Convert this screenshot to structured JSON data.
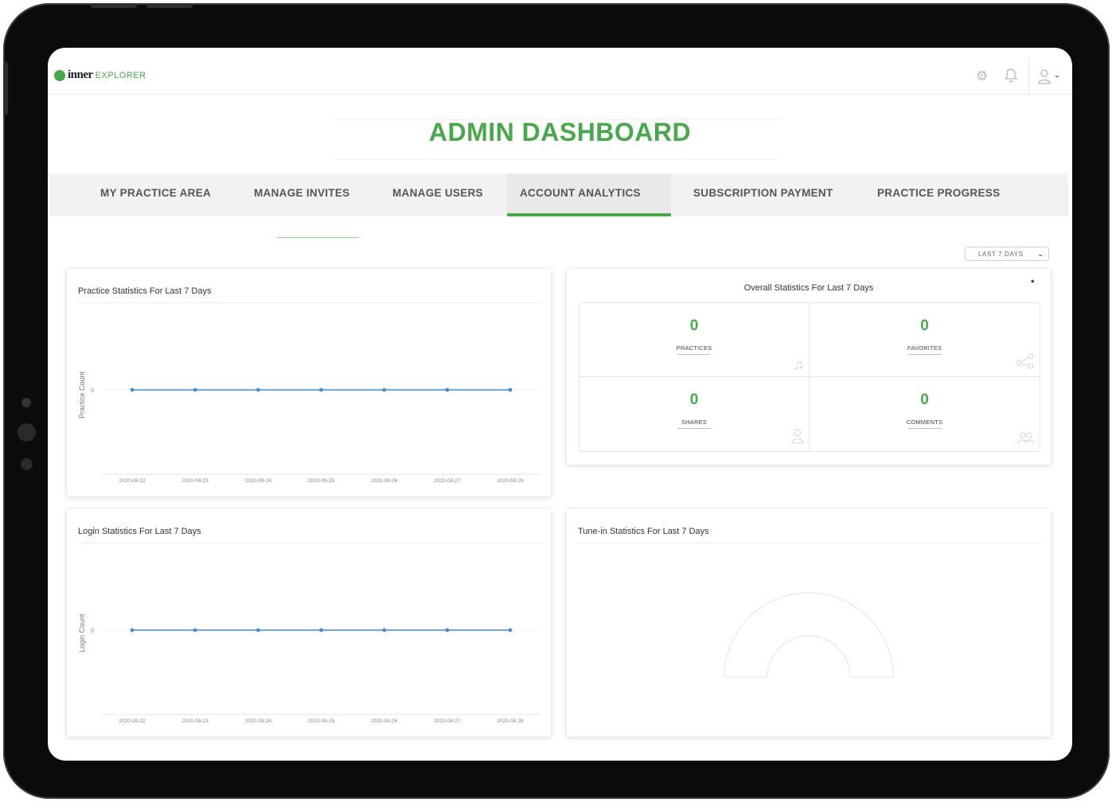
{
  "app": {
    "logo_inner": "inner",
    "logo_explorer": "EXPLORER",
    "page_title": "ADMIN DASHBOARD"
  },
  "header_icons": {
    "settings": "gear-icon",
    "notifications": "bell-icon",
    "user": "user-icon"
  },
  "tabs": [
    {
      "label": "MY PRACTICE AREA",
      "active": false
    },
    {
      "label": "MANAGE INVITES",
      "active": false
    },
    {
      "label": "MANAGE USERS",
      "active": false
    },
    {
      "label": "ACCOUNT ANALYTICS",
      "active": true
    },
    {
      "label": "SUBSCRIPTION PAYMENT",
      "active": false
    },
    {
      "label": "PRACTICE PROGRESS",
      "active": false
    }
  ],
  "filter": {
    "selected": "LAST 7 DAYS"
  },
  "practice_card": {
    "title": "Practice Statistics For Last 7 Days"
  },
  "overall_card": {
    "title": "Overall Statistics For Last 7 Days",
    "info_icon": "info-icon",
    "stats": [
      {
        "value": "0",
        "label": "PRACTICES",
        "icon": "music-icon"
      },
      {
        "value": "0",
        "label": "FAVORITES",
        "icon": "share-icon"
      },
      {
        "value": "0",
        "label": "SHARES",
        "icon": "person-icon"
      },
      {
        "value": "0",
        "label": "COMMENTS",
        "icon": "group-icon"
      }
    ]
  },
  "login_card": {
    "title": "Login Statistics For Last 7 Days"
  },
  "tunein_card": {
    "title": "Tune-in Statistics For Last 7 Days"
  },
  "colors": {
    "accent": "#49a84c",
    "line": "#3d8fd6"
  },
  "chart_data": [
    {
      "type": "line",
      "x": [
        "2020-08-22",
        "2020-08-23",
        "2020-08-24",
        "2020-08-25",
        "2020-08-26",
        "2020-08-27",
        "2020-08-28"
      ],
      "series": [
        {
          "values": [
            0,
            0,
            0,
            0,
            0,
            0,
            0
          ]
        }
      ],
      "ylabel": "Practice Count",
      "yticks": [
        "0"
      ]
    },
    {
      "type": "line",
      "x": [
        "2020-08-22",
        "2020-08-23",
        "2020-08-24",
        "2020-08-25",
        "2020-08-26",
        "2020-08-27",
        "2020-08-28"
      ],
      "series": [
        {
          "values": [
            0,
            0,
            0,
            0,
            0,
            0,
            0
          ]
        }
      ],
      "ylabel": "Login Count",
      "yticks": [
        "0"
      ]
    },
    {
      "type": "pie",
      "values": [],
      "style": "half-donut, empty"
    }
  ]
}
